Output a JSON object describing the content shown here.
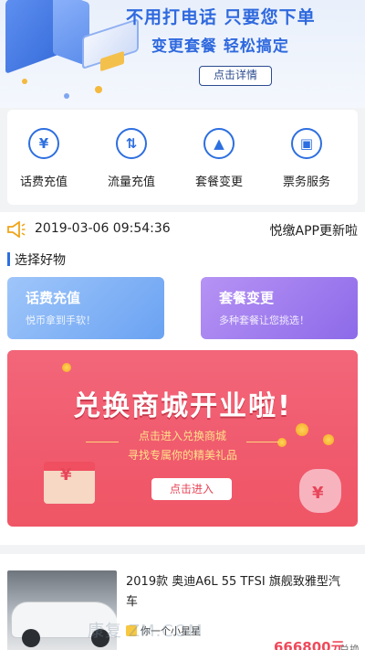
{
  "banner": {
    "headline": "不用打电话  只要您下单",
    "subline": "变更套餐   轻松搞定",
    "detail_button": "点击详情",
    "accent_color": "#2f69de"
  },
  "services": [
    {
      "label": "话费充值",
      "icon": "yen-icon",
      "glyph": "¥"
    },
    {
      "label": "流量充值",
      "icon": "transfer-icon",
      "glyph": "⇅"
    },
    {
      "label": "套餐变更",
      "icon": "chart-icon",
      "glyph": "▲"
    },
    {
      "label": "票务服务",
      "icon": "ticket-icon",
      "glyph": "▣"
    }
  ],
  "notice": {
    "datetime": "2019-03-06 09:54:36",
    "message": "悦缴APP更新啦"
  },
  "section": {
    "title": "选择好物"
  },
  "promos": [
    {
      "title": "话费充值",
      "subtitle": "悦币拿到手软！"
    },
    {
      "title": "套餐变更",
      "subtitle": "多种套餐让您挑选！"
    }
  ],
  "mall": {
    "headline": "兑换商城开业啦!",
    "line1": "点击进入兑换商城",
    "line2": "寻找专属你的精美礼品",
    "enter_button": "点击进入",
    "yen_glyph": "¥"
  },
  "product": {
    "title": "2019款 奥迪A6L 55 TFSI 旗舰致雅型汽车",
    "shop": "你一个小星星",
    "price": "666800元",
    "price_suffix": "兑换"
  },
  "watermark": "康复 ZM.COM"
}
